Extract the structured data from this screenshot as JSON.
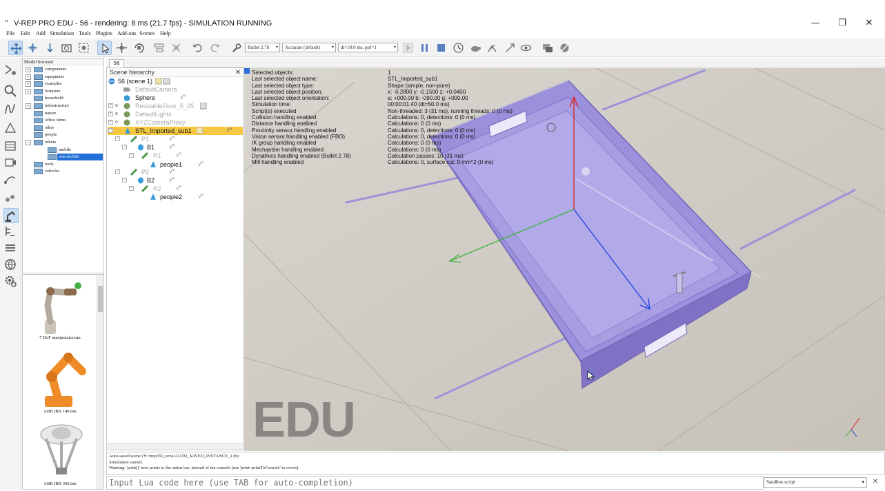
{
  "window": {
    "title": "V-REP PRO EDU - 56 - rendering: 8 ms (21.7 fps) - SIMULATION RUNNING",
    "logo_glyph": "ʺ",
    "minimize_glyph": "—",
    "restore_glyph": "❐",
    "close_glyph": "✕"
  },
  "menu": [
    "File",
    "Edit",
    "Add",
    "Simulation",
    "Tools",
    "Plugins",
    "Add-ons",
    "Scenes",
    "Help"
  ],
  "toolbar": {
    "physics_engine": "Bullet 2.78",
    "accuracy": "Accurate (default)",
    "timestep": "dt=50.0 ms, ppf=1",
    "dropdown_arrow": "▾"
  },
  "model_browser": {
    "title": "Model browser",
    "items": [
      {
        "label": "components",
        "expandable": true
      },
      {
        "label": "equipment",
        "expandable": true
      },
      {
        "label": "examples",
        "expandable": true
      },
      {
        "label": "furniture",
        "expandable": true
      },
      {
        "label": "household",
        "expandable": false
      },
      {
        "label": "infrastructure",
        "expandable": true
      },
      {
        "label": "nature",
        "expandable": false
      },
      {
        "label": "office items",
        "expandable": false
      },
      {
        "label": "other",
        "expandable": false
      },
      {
        "label": "people",
        "expandable": false
      },
      {
        "label": "robots",
        "expandable": true,
        "expanded": true
      },
      {
        "label": "mobile",
        "expandable": false,
        "indent": 1
      },
      {
        "label": "non-mobile",
        "expandable": false,
        "indent": 1,
        "selected": true
      },
      {
        "label": "tools",
        "expandable": false
      },
      {
        "label": "vehicles",
        "expandable": false
      }
    ],
    "expand_glyph": "+",
    "collapse_glyph": "−"
  },
  "thumbnails": [
    {
      "caption": "7 DoF manipulator.ttm"
    },
    {
      "caption": "ABB IRB 140.ttm"
    },
    {
      "caption": "ABB IRB 360.ttm"
    }
  ],
  "scene_hierarchy": {
    "title": "Scene hierarchy",
    "close_glyph": "✕",
    "tab_label": "56",
    "rows": [
      {
        "label": "56 (scene 1)",
        "dim": false
      },
      {
        "label": "DefaultCamera",
        "dim": true
      },
      {
        "label": "Sphere",
        "dim": false
      },
      {
        "label": "ResizableFloor_5_25",
        "dim": true
      },
      {
        "label": "DefaultLights",
        "dim": true
      },
      {
        "label": "XYZCameraProxy",
        "dim": true
      },
      {
        "label": "STL_Imported_sub1",
        "dim": false,
        "selected": true
      },
      {
        "label": "P1",
        "dim": true
      },
      {
        "label": "B1",
        "dim": false
      },
      {
        "label": "R1",
        "dim": true
      },
      {
        "label": "people1",
        "dim": false
      },
      {
        "label": "P2",
        "dim": true
      },
      {
        "label": "B2",
        "dim": false
      },
      {
        "label": "R2",
        "dim": true
      },
      {
        "label": "people2",
        "dim": false
      }
    ]
  },
  "info_overlay": [
    {
      "key": "Selected objects:",
      "value": "1"
    },
    {
      "key": "Last selected object name:",
      "value": "STL_Imported_sub1"
    },
    {
      "key": "Last selected object type:",
      "value": "Shape (simple, non-pure)"
    },
    {
      "key": "Last selected object position:",
      "value": "x: -0.2800   y: -0.1500   z: +0.0400"
    },
    {
      "key": "Last selected object orientation:",
      "value": "a: +000.00   b: -090.00   g: +000.00"
    },
    {
      "key": "Simulation time:",
      "value": "00:00:01.40 (dt=50.0 ms)"
    },
    {
      "key": "Script(s) executed",
      "value": "Non-threaded: 3 (31 ms), running threads: 0 (0 ms)"
    },
    {
      "key": "Collision handling enabled",
      "value": "Calculations: 0, detections: 0 (0 ms)"
    },
    {
      "key": "Distance handling enabled",
      "value": "Calculations: 0 (0 ms)"
    },
    {
      "key": "Proximity sensor handling enabled",
      "value": "Calculations: 0, detections: 0 (0 ms)"
    },
    {
      "key": "Vision sensor handling enabled (FBO)",
      "value": "Calculations: 0, detections: 0 (0 ms)"
    },
    {
      "key": "IK group handling enabled",
      "value": "Calculations: 0 (0 ms)"
    },
    {
      "key": "Mechanism handling enabled",
      "value": "Calculations: 0 (0 ms)"
    },
    {
      "key": "Dynamics handling enabled (Bullet 2.78)",
      "value": "Calculation passes: 10 (31 ms)"
    },
    {
      "key": "Mill handling enabled",
      "value": "Calculations: 0, surface cut: 0 mm^2 (0 ms)"
    }
  ],
  "watermark": "EDU",
  "console": {
    "lines": [
      "Auto-saved scene (Y:/vrep350_rev4/AUTO_SAVED_INSTANCE_1.ttt)",
      "Simulation started.",
      "Warning: 'print()' now prints to the status bar, instead of the console (use 'print=printToConsole' to revert)."
    ],
    "lua_placeholder": "Input Lua code here (use TAB for auto-completion)",
    "script_selector": "Sandbox script",
    "close_glyph": "✕"
  },
  "colors": {
    "selection_yellow": "#f5c842",
    "selection_blue": "#1f6fd6",
    "tray_purple": "#8f84d6",
    "axis_red": "#e02020",
    "axis_green": "#3cb43c",
    "axis_blue": "#2040e0"
  }
}
